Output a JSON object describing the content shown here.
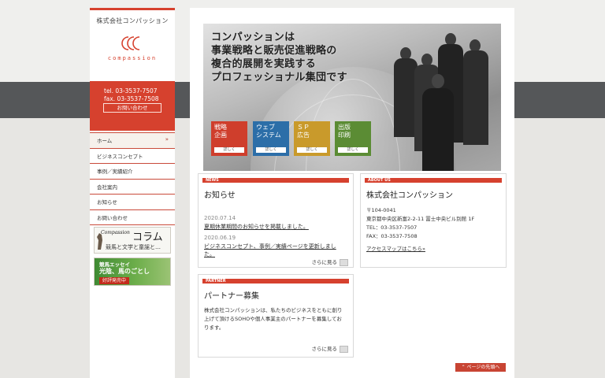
{
  "sidebar": {
    "company_name": "株式会社コンパッション",
    "logo_word": "compassion",
    "tel": "tel. 03-3537-7507",
    "fax": "fax. 03-3537-7508",
    "inquiry_button": "お問い合わせ",
    "nav": [
      {
        "label": "ホーム",
        "arrow": "»"
      },
      {
        "label": "ビジネスコンセプト"
      },
      {
        "label": "事例／実績紹介"
      },
      {
        "label": "会社案内"
      },
      {
        "label": "お知らせ"
      },
      {
        "label": "お問い合わせ"
      }
    ],
    "banner_column": {
      "small": "Compassion",
      "big": "コラム",
      "sub": "競馬と文学と童謡と…"
    },
    "banner_keiba": {
      "line1": "競馬エッセイ",
      "line2": "光陰、馬のごとし",
      "badge": "好評発売中"
    }
  },
  "hero": {
    "title_lines": [
      "コンパッションは",
      "事業戦略と販売促進戦略の",
      "複合的展開を実践する",
      "プロフェッショナル集団です"
    ],
    "tiles": [
      {
        "line1": "戦略",
        "line2": "企画",
        "detail": "詳しく"
      },
      {
        "line1": "ウェブ",
        "line2": "システム",
        "detail": "詳しく"
      },
      {
        "line1": "ＳＰ",
        "line2": "広告",
        "detail": "詳しく"
      },
      {
        "line1": "出版",
        "line2": "印刷",
        "detail": "詳しく"
      }
    ]
  },
  "news": {
    "tab": "NEWS",
    "title": "お知らせ",
    "items": [
      {
        "date": "2020.07.14",
        "text": "夏期休業期間のお知らせを掲載しました。"
      },
      {
        "date": "2020.06.19",
        "text": "ビジネスコンセプト、事例／実績ページを更新しました。"
      }
    ],
    "more": "さらに見る"
  },
  "about": {
    "tab": "ABOUT US",
    "title": "株式会社コンパッション",
    "postal": "〒104-0041",
    "address": "東京都中央区新富2-2-11 冨士中央ビル別館 1F",
    "tel": "TEL：03-3537-7507",
    "fax": "FAX：03-3537-7508",
    "map_link": "アクセスマップはこちら»"
  },
  "partner": {
    "tab": "PARTNER",
    "title": "パートナー募集",
    "text": "株式会社コンパッションは、私たちのビジネスをともに創り上げて頂けるSOHOや個人事業主のパートナーを募集しております。",
    "more": "さらに見る"
  },
  "page_top": "ページの先頭へ",
  "colors": {
    "accent": "#d6412e",
    "dark_band": "#555759"
  }
}
